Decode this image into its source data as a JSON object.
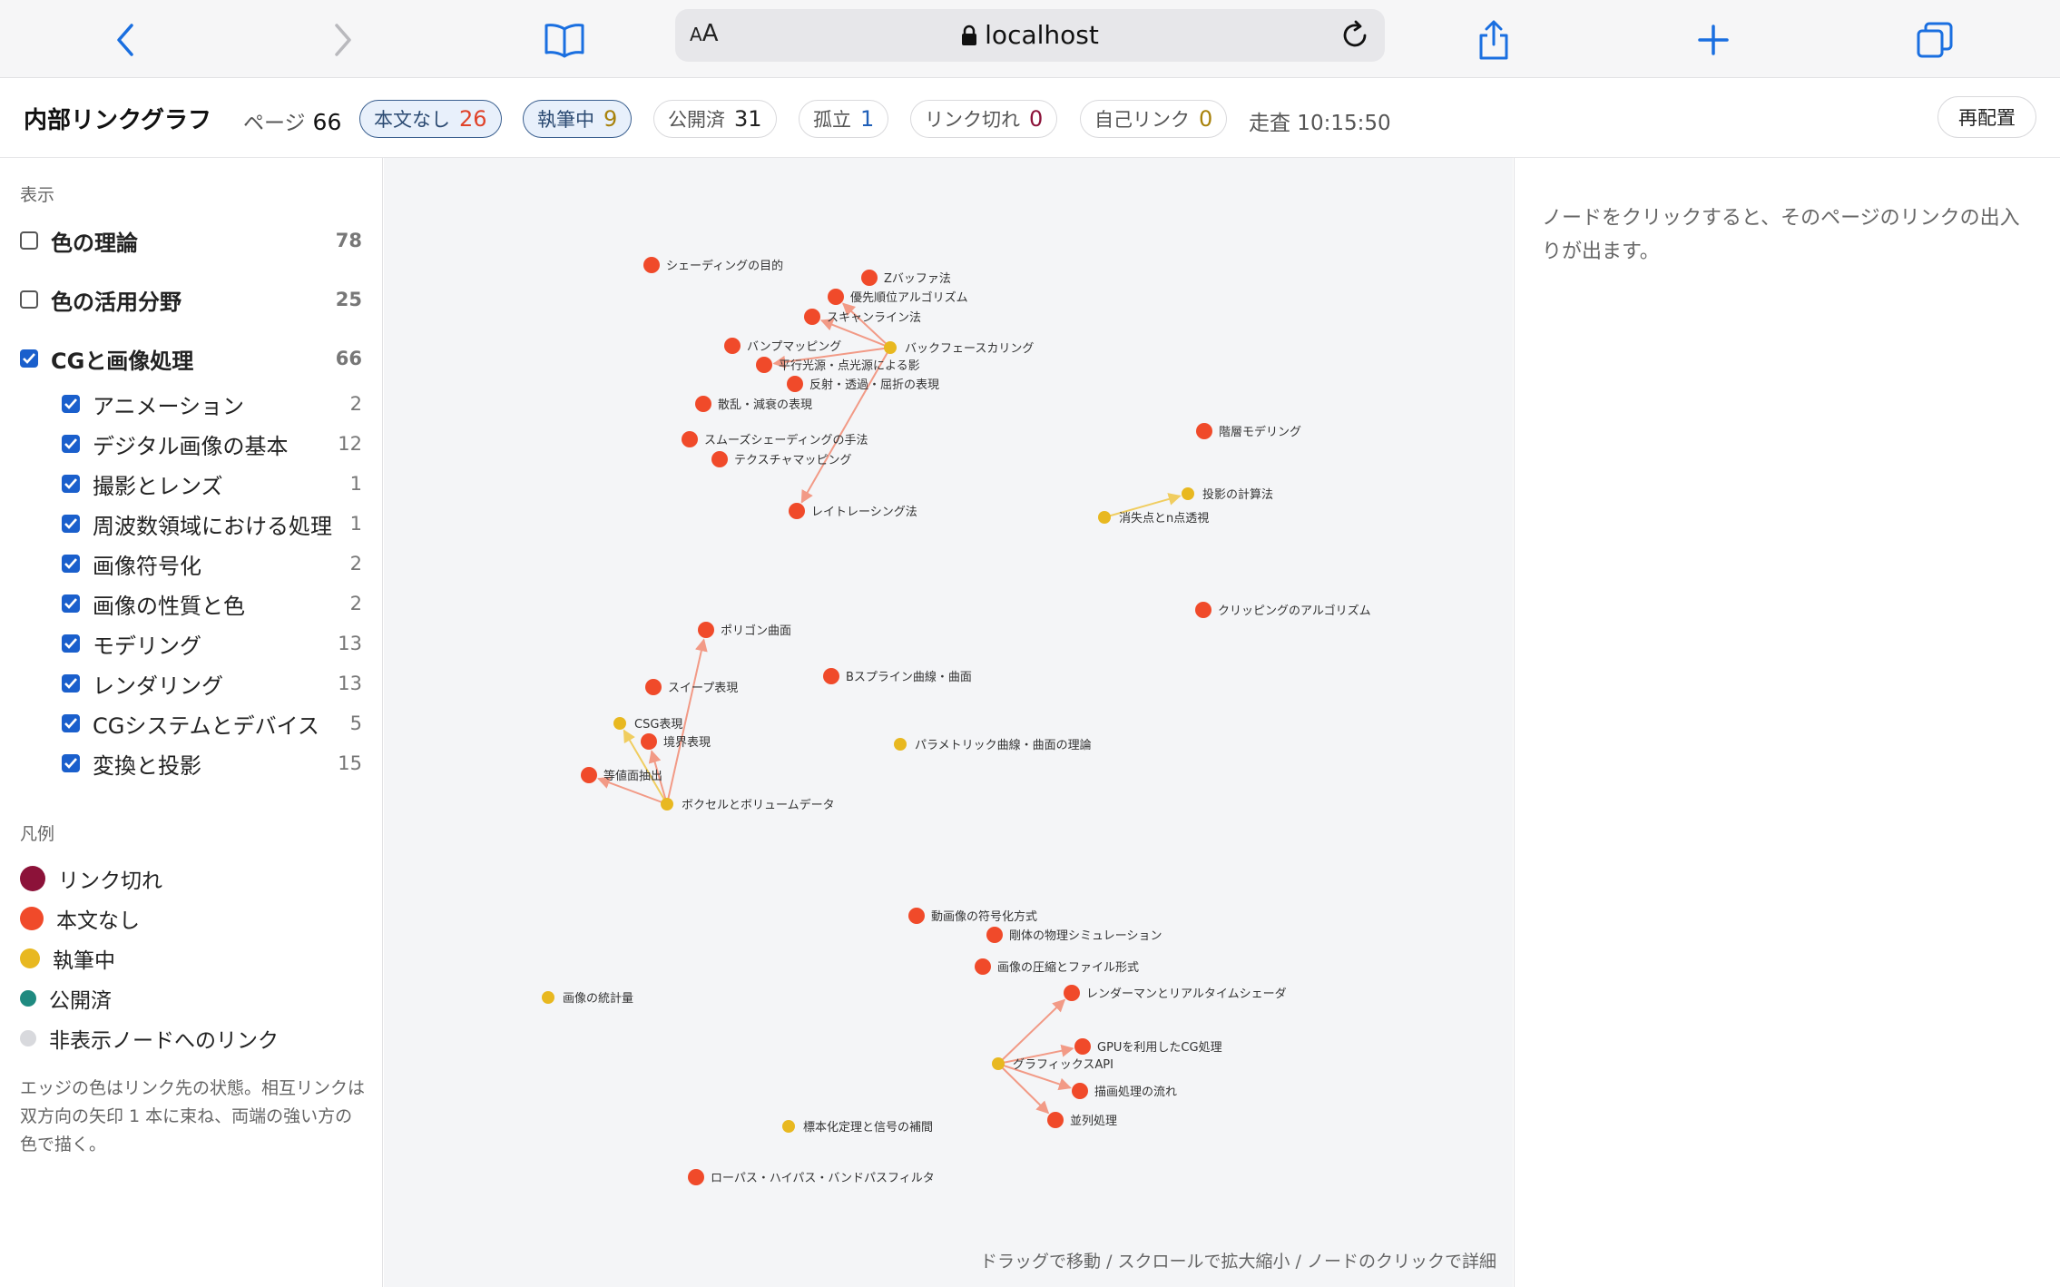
{
  "browser": {
    "back_icon": "chevron-left-icon",
    "forward_icon": "chevron-right-icon",
    "bookmarks_icon": "book-icon",
    "aa_label": "AA",
    "url": "localhost",
    "share_icon": "share-icon",
    "new_tab_icon": "plus-icon",
    "tabs_icon": "tabs-icon"
  },
  "header": {
    "title": "内部リンクグラフ",
    "page_label": "ページ",
    "page_count": "66",
    "pills": [
      {
        "label": "本文なし",
        "count": "26",
        "color": "#e0432a",
        "active": true
      },
      {
        "label": "執筆中",
        "count": "9",
        "color": "#a8820b",
        "active": true
      },
      {
        "label": "公開済",
        "count": "31",
        "color": "#222222",
        "active": false
      },
      {
        "label": "孤立",
        "count": "1",
        "color": "#1f5fb8",
        "active": false
      },
      {
        "label": "リンク切れ",
        "count": "0",
        "color": "#8c1239",
        "active": false
      },
      {
        "label": "自己リンク",
        "count": "0",
        "color": "#a8820b",
        "active": false
      }
    ],
    "scan_label": "走査 10:15:50",
    "relayout_label": "再配置"
  },
  "sidebar": {
    "display_label": "表示",
    "top_groups": [
      {
        "label": "色の理論",
        "count": "78",
        "checked": false
      },
      {
        "label": "色の活用分野",
        "count": "25",
        "checked": false
      },
      {
        "label": "CGと画像処理",
        "count": "66",
        "checked": true
      }
    ],
    "children": [
      {
        "label": "アニメーション",
        "count": "2"
      },
      {
        "label": "デジタル画像の基本",
        "count": "12"
      },
      {
        "label": "撮影とレンズ",
        "count": "1"
      },
      {
        "label": "周波数領域における処理",
        "count": "1"
      },
      {
        "label": "画像符号化",
        "count": "2"
      },
      {
        "label": "画像の性質と色",
        "count": "2"
      },
      {
        "label": "モデリング",
        "count": "13"
      },
      {
        "label": "レンダリング",
        "count": "13"
      },
      {
        "label": "CGシステムとデバイス",
        "count": "5"
      },
      {
        "label": "変換と投影",
        "count": "15"
      }
    ],
    "legend_label": "凡例",
    "legend": [
      {
        "label": "リンク切れ",
        "color": "#8c1239"
      },
      {
        "label": "本文なし",
        "color": "#f04a2a"
      },
      {
        "label": "執筆中",
        "color": "#e8b820"
      },
      {
        "label": "公開済",
        "color": "#1f8a80"
      },
      {
        "label": "非表示ノードへのリンク",
        "color": "#d8d9dd"
      }
    ],
    "note": "エッジの色はリンク先の状態。相互リンクは双方向の矢印 1 本に束ね、両端の強い方の色で描く。"
  },
  "graph": {
    "colors": {
      "none": "#f04a2a",
      "draft": "#e8b820",
      "edge_none": "#f29a86",
      "edge_draft": "#f0cd60"
    },
    "nodes": [
      {
        "id": "n1",
        "label": "シェーディングの目的",
        "status": "none"
      },
      {
        "id": "n2",
        "label": "Zバッファ法",
        "status": "none"
      },
      {
        "id": "n3",
        "label": "優先順位アルゴリズム",
        "status": "none"
      },
      {
        "id": "n4",
        "label": "スキャンライン法",
        "status": "none"
      },
      {
        "id": "n5",
        "label": "バンプマッピング",
        "status": "none"
      },
      {
        "id": "n6",
        "label": "バックフェースカリング",
        "status": "draft"
      },
      {
        "id": "n7",
        "label": "平行光源・点光源による影",
        "status": "none"
      },
      {
        "id": "n8",
        "label": "反射・透過・屈折の表現",
        "status": "none"
      },
      {
        "id": "n9",
        "label": "散乱・減衰の表現",
        "status": "none"
      },
      {
        "id": "n10",
        "label": "スムーズシェーディングの手法",
        "status": "none"
      },
      {
        "id": "n11",
        "label": "テクスチャマッピング",
        "status": "none"
      },
      {
        "id": "n12",
        "label": "レイトレーシング法",
        "status": "none"
      },
      {
        "id": "n13",
        "label": "階層モデリング",
        "status": "none"
      },
      {
        "id": "n14",
        "label": "投影の計算法",
        "status": "draft"
      },
      {
        "id": "n15",
        "label": "消失点とn点透視",
        "status": "draft"
      },
      {
        "id": "n16",
        "label": "クリッピングのアルゴリズム",
        "status": "none"
      },
      {
        "id": "n17",
        "label": "ポリゴン曲面",
        "status": "none"
      },
      {
        "id": "n18",
        "label": "Bスプライン曲線・曲面",
        "status": "none"
      },
      {
        "id": "n19",
        "label": "スイープ表現",
        "status": "none"
      },
      {
        "id": "n20",
        "label": "CSG表現",
        "status": "draft"
      },
      {
        "id": "n21",
        "label": "境界表現",
        "status": "none"
      },
      {
        "id": "n22",
        "label": "パラメトリック曲線・曲面の理論",
        "status": "draft"
      },
      {
        "id": "n23",
        "label": "等値面抽出",
        "status": "none"
      },
      {
        "id": "n24",
        "label": "ボクセルとボリュームデータ",
        "status": "draft"
      },
      {
        "id": "n25",
        "label": "動画像の符号化方式",
        "status": "none"
      },
      {
        "id": "n26",
        "label": "剛体の物理シミュレーション",
        "status": "none"
      },
      {
        "id": "n27",
        "label": "画像の圧縮とファイル形式",
        "status": "none"
      },
      {
        "id": "n28",
        "label": "レンダーマンとリアルタイムシェーダ",
        "status": "none"
      },
      {
        "id": "n29",
        "label": "画像の統計量",
        "status": "draft"
      },
      {
        "id": "n30",
        "label": "GPUを利用したCG処理",
        "status": "none"
      },
      {
        "id": "n31",
        "label": "グラフィックスAPI",
        "status": "draft"
      },
      {
        "id": "n32",
        "label": "描画処理の流れ",
        "status": "none"
      },
      {
        "id": "n33",
        "label": "標本化定理と信号の補間",
        "status": "draft"
      },
      {
        "id": "n34",
        "label": "並列処理",
        "status": "none"
      },
      {
        "id": "n35",
        "label": "ローパス・ハイパス・バンドパスフィルタ",
        "status": "none"
      }
    ],
    "edges": [
      {
        "from": "n6",
        "to": "n3"
      },
      {
        "from": "n6",
        "to": "n4"
      },
      {
        "from": "n6",
        "to": "n7"
      },
      {
        "from": "n6",
        "to": "n12"
      },
      {
        "from": "n15",
        "to": "n14"
      },
      {
        "from": "n24",
        "to": "n17"
      },
      {
        "from": "n24",
        "to": "n20"
      },
      {
        "from": "n24",
        "to": "n21"
      },
      {
        "from": "n24",
        "to": "n23"
      },
      {
        "from": "n31",
        "to": "n28"
      },
      {
        "from": "n31",
        "to": "n30"
      },
      {
        "from": "n31",
        "to": "n32"
      },
      {
        "from": "n31",
        "to": "n34"
      }
    ],
    "hint": "ドラッグで移動 / スクロールで拡大縮小 / ノードのクリックで詳細"
  },
  "detail": {
    "text": "ノードをクリックすると、そのページのリンクの出入りが出ます。"
  }
}
